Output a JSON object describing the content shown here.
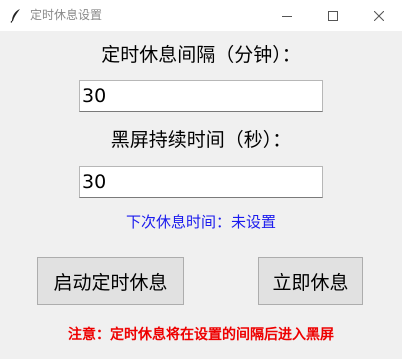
{
  "window": {
    "title": "定时休息设置",
    "icon": "feather-icon"
  },
  "form": {
    "interval_label": "定时休息间隔（分钟）：",
    "interval_value": "30",
    "duration_label": "黑屏持续时间（秒）：",
    "duration_value": "30"
  },
  "status": {
    "next_rest_text": "下次休息时间：未设置",
    "color": "#1a1aee"
  },
  "buttons": {
    "start_label": "启动定时休息",
    "now_label": "立即休息"
  },
  "notice": {
    "text": "注意：定时休息将在设置的间隔后进入黑屏",
    "color": "#ee0000"
  }
}
